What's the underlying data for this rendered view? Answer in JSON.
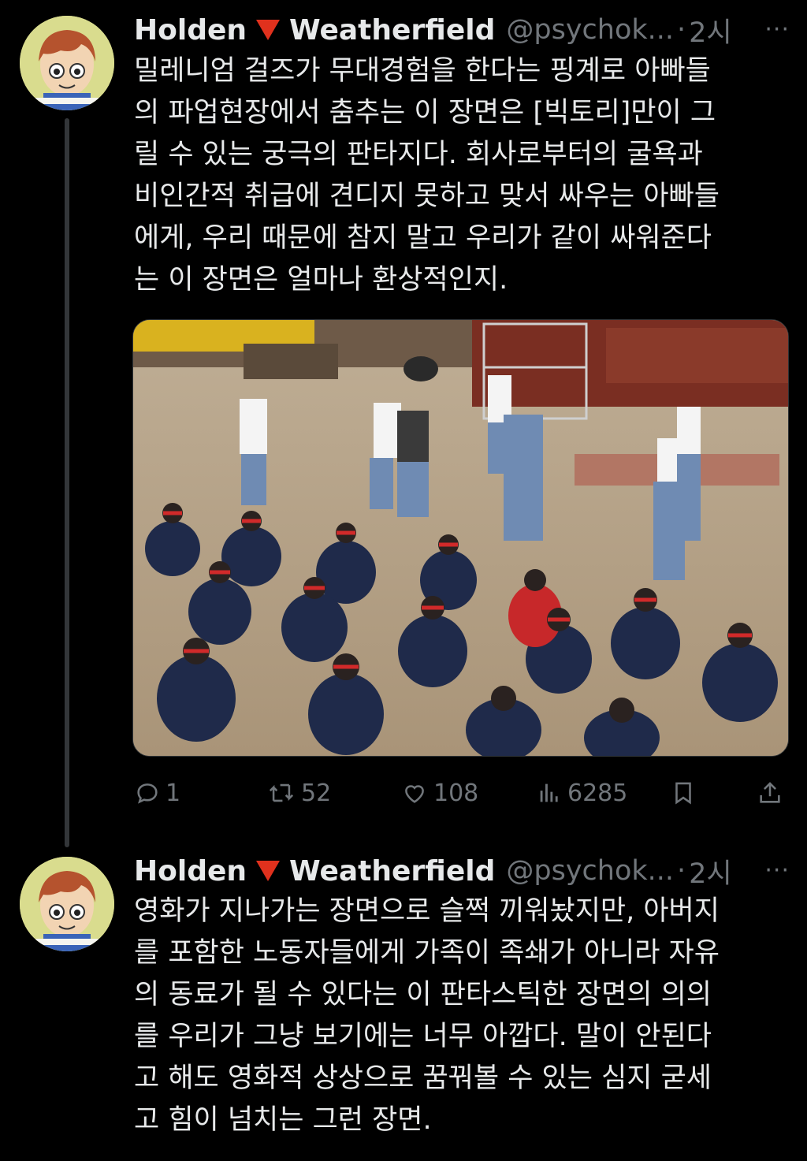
{
  "tweets": [
    {
      "author_name": "Holden",
      "author_name_rest": "Weatherfield",
      "handle": "@psychok...",
      "time": "2시",
      "more": "···",
      "lines": [
        "밀레니엄 걸즈가 무대경험을 한다는 핑계로 아빠들",
        "의 파업현장에서 춤추는 이 장면은 [빅토리]만이 그",
        "릴 수 있는 궁극의 판타지다. 회사로부터의 굴욕과",
        "비인간적 취급에 견디지 못하고 맞서 싸우는 아빠들",
        "에게, 우리 때문에 참지 말고 우리가 같이 싸워준다",
        "는 이 장면은 얼마나 환상적인지."
      ],
      "actions": {
        "replies": "1",
        "reposts": "52",
        "likes": "108",
        "views": "6285"
      }
    },
    {
      "author_name": "Holden",
      "author_name_rest": "Weatherfield",
      "handle": "@psychok...",
      "time": "2시",
      "more": "···",
      "lines": [
        "영화가 지나가는 장면으로 슬쩍 끼워놨지만, 아버지",
        "를 포함한 노동자들에게 가족이 족쇄가 아니라 자유",
        "의 동료가 될 수 있다는 이 판타스틱한 장면의 의의",
        "를 우리가 그냥 보기에는 너무 아깝다. 말이 안된다",
        "고 해도 영화적 상상으로 꿈꿔볼 수 있는 심지 굳세",
        "고 힘이 넘치는 그런 장면."
      ]
    }
  ],
  "colors": {
    "background": "#000000",
    "text": "#e7e9ea",
    "secondary": "#71767b",
    "flag": "#e0311d"
  }
}
